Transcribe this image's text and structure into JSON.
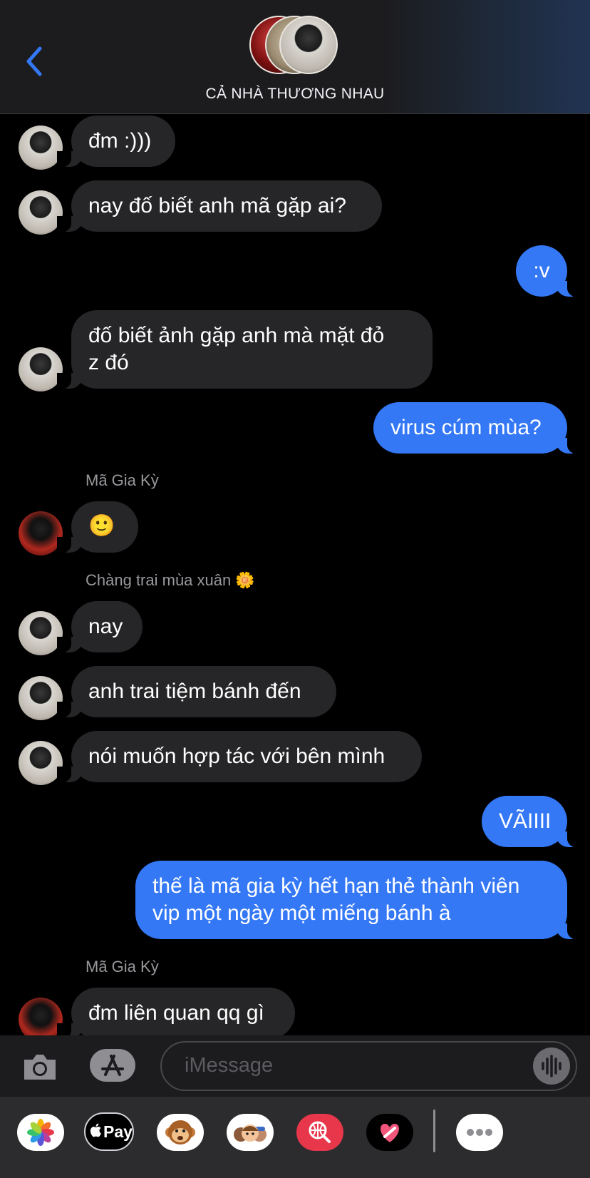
{
  "header": {
    "title": "CẢ NHÀ THƯƠNG NHAU"
  },
  "messages": [
    {
      "dir": "in",
      "text": "đm :)))"
    },
    {
      "dir": "in",
      "text": "nay đố biết anh mã gặp ai?"
    },
    {
      "dir": "out",
      "text": ":v"
    },
    {
      "dir": "in",
      "lines": [
        "đố biết ảnh gặp anh mà mặt đỏ",
        "z đó"
      ]
    },
    {
      "dir": "out",
      "text": "virus cúm mùa?"
    },
    {
      "sender": "Mã Gia Kỳ"
    },
    {
      "dir": "in",
      "text": "🙂"
    },
    {
      "sender": "Chàng trai mùa xuân 🌼"
    },
    {
      "dir": "in",
      "text": "nay"
    },
    {
      "dir": "in",
      "text": "anh trai tiệm bánh đến"
    },
    {
      "dir": "in",
      "text": "nói muốn hợp tác với bên mình"
    },
    {
      "dir": "out",
      "text": "VÃIIII"
    },
    {
      "dir": "out",
      "lines": [
        "thế là mã gia kỳ hết hạn thẻ thành viên",
        "vip một ngày một miếng bánh à"
      ]
    },
    {
      "sender": "Mã Gia Kỳ"
    },
    {
      "dir": "in",
      "text": "đm liên quan qq gì"
    }
  ],
  "composer": {
    "placeholder": "iMessage"
  },
  "app_strip": {
    "apps": [
      "photos-app",
      "apple-pay-app",
      "animoji-app",
      "memoji-app",
      "images-search-app",
      "digital-touch-app"
    ],
    "apple_pay_label": "Pay",
    "more_icon": "more-icon"
  },
  "colors": {
    "outgoing": "#3478f6",
    "incoming": "#262628",
    "accent": "#3478f6"
  }
}
